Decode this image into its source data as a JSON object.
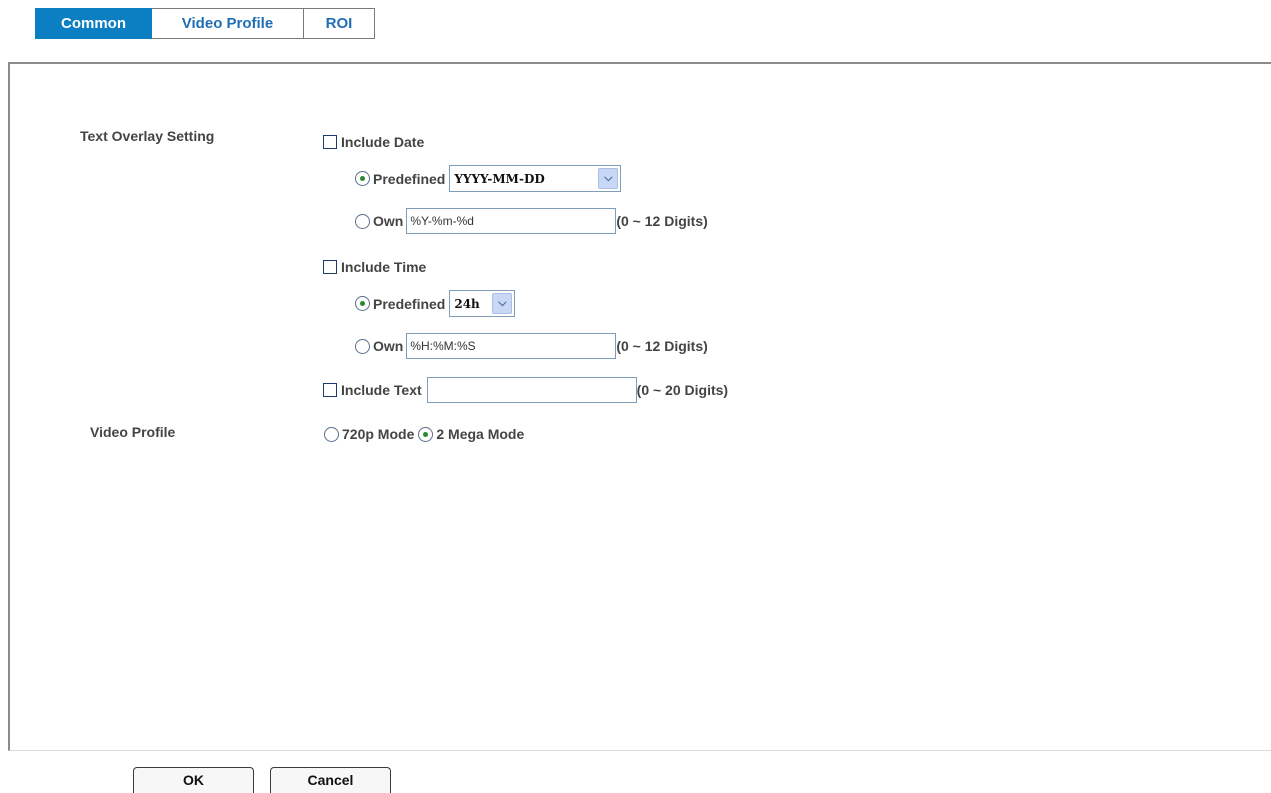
{
  "tabs": [
    {
      "label": "Common"
    },
    {
      "label": "Video Profile"
    },
    {
      "label": "ROI"
    }
  ],
  "text_overlay": {
    "section_label": "Text Overlay Setting",
    "include_date": {
      "label": "Include Date",
      "checked": false,
      "predefined_label": "Predefined",
      "predefined_value": "YYYY-MM-DD",
      "own_label": "Own",
      "own_value": "%Y-%m-%d",
      "own_hint": "(0 ~ 12 Digits)"
    },
    "include_time": {
      "label": "Include Time",
      "checked": false,
      "predefined_label": "Predefined",
      "predefined_value": "24h",
      "own_label": "Own",
      "own_value": "%H:%M:%S",
      "own_hint": "(0 ~ 12 Digits)"
    },
    "include_text": {
      "label": "Include Text",
      "checked": false,
      "value": "",
      "hint": "(0 ~ 20 Digits)"
    }
  },
  "video_profile": {
    "section_label": "Video Profile",
    "option_720p": "720p Mode",
    "option_2mega": "2 Mega Mode",
    "selected": "2 Mega Mode"
  },
  "buttons": {
    "ok": "OK",
    "cancel": "Cancel"
  },
  "colors": {
    "tab_active_bg": "#0b7fc1",
    "tab_text": "#1f6fb6",
    "radio_dot": "#2a8a2a"
  }
}
